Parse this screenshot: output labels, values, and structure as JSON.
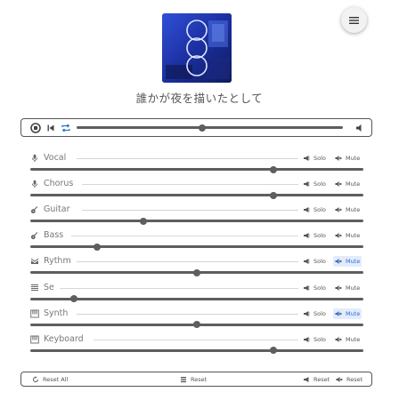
{
  "header": {
    "menu_icon": "hamburger-icon",
    "song_title": "誰かが夜を描いたとして"
  },
  "transport": {
    "icons": [
      "stop-icon",
      "previous-icon",
      "repeat-icon",
      "volume-icon"
    ],
    "repeat_color": "#2f6fd6",
    "position": 0.47
  },
  "channels": [
    {
      "id": "vocal",
      "name": "Vocal",
      "icon": "microphone-icon",
      "level": 0.73,
      "solo": "Solo",
      "mute": "Mute",
      "muted": false
    },
    {
      "id": "chorus",
      "name": "Chorus",
      "icon": "microphone-icon",
      "level": 0.73,
      "solo": "Solo",
      "mute": "Mute",
      "muted": false
    },
    {
      "id": "guitar",
      "name": "Guitar",
      "icon": "guitar-icon",
      "level": 0.34,
      "solo": "Solo",
      "mute": "Mute",
      "muted": false
    },
    {
      "id": "bass",
      "name": "Bass",
      "icon": "guitar-icon",
      "level": 0.2,
      "solo": "Solo",
      "mute": "Mute",
      "muted": false
    },
    {
      "id": "rythm",
      "name": "Rythm",
      "icon": "drum-icon",
      "level": 0.5,
      "solo": "Solo",
      "mute": "Mute",
      "muted": true
    },
    {
      "id": "se",
      "name": "Se",
      "icon": "sheet-icon",
      "level": 0.13,
      "solo": "Solo",
      "mute": "Mute",
      "muted": false
    },
    {
      "id": "synth",
      "name": "Synth",
      "icon": "keyboard-icon",
      "level": 0.5,
      "solo": "Solo",
      "mute": "Mute",
      "muted": true
    },
    {
      "id": "keyboard",
      "name": "Keyboard",
      "icon": "keyboard-icon",
      "level": 0.73,
      "solo": "Solo",
      "mute": "Mute",
      "muted": false
    }
  ],
  "footer": {
    "reset_all": "Reset All",
    "reset_levels": "Reset",
    "reset_solo": "Reset",
    "reset_mute": "Reset"
  },
  "colors": {
    "accent": "#2f6fd6",
    "accent_bg": "#e3ecfb",
    "rail": "#5e5e5e",
    "thin_rail": "#d6d6d6"
  }
}
